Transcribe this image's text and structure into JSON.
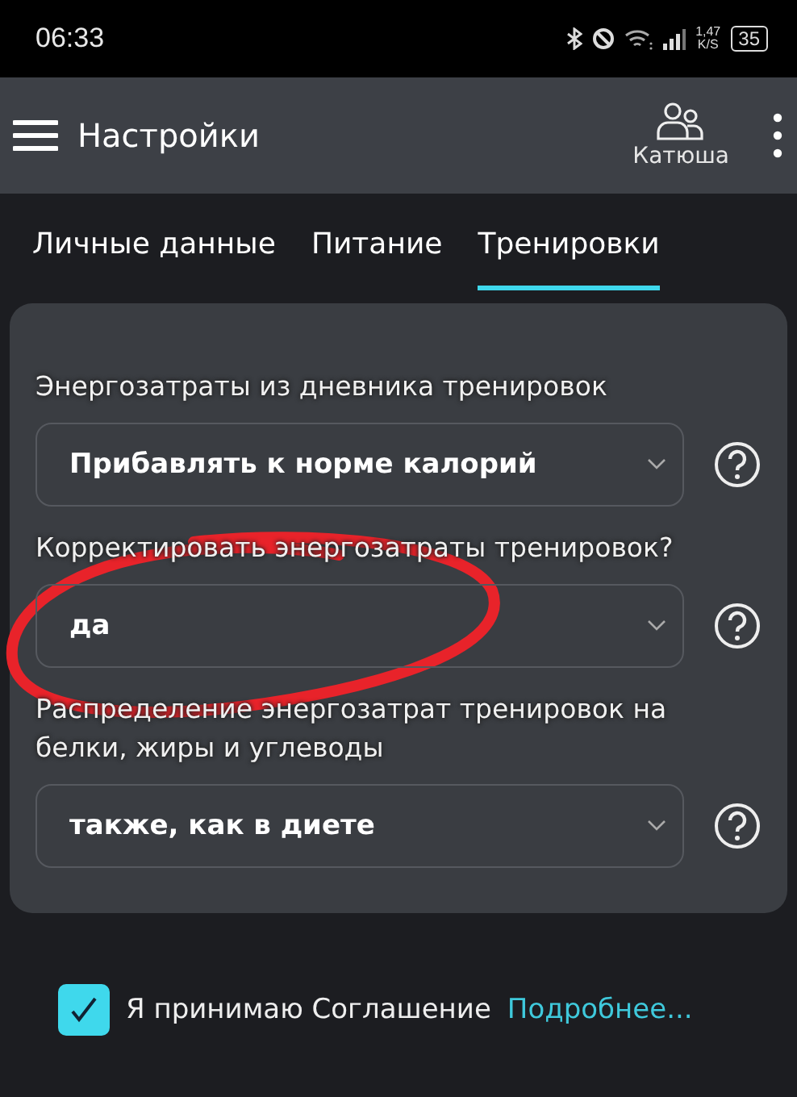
{
  "status_bar": {
    "time": "06:33",
    "speed_value": "1,47",
    "speed_unit": "K/S",
    "battery": "35"
  },
  "header": {
    "title": "Настройки",
    "profile": "Катюша"
  },
  "tabs": [
    {
      "label": "Личные данные",
      "selected": false
    },
    {
      "label": "Питание",
      "selected": false
    },
    {
      "label": "Тренировки",
      "selected": true
    }
  ],
  "settings": [
    {
      "label": "Энергозатраты из дневника тренировок",
      "value": "Прибавлять к норме калорий"
    },
    {
      "label": "Корректировать энергозатраты тренировок?",
      "value": "да"
    },
    {
      "label": "Распределение энергозатрат тренировок на белки, жиры и углеводы",
      "value": "также, как в диете"
    }
  ],
  "agreement": {
    "checked": true,
    "text": "Я принимаю Соглашение",
    "link": "Подробнее..."
  }
}
